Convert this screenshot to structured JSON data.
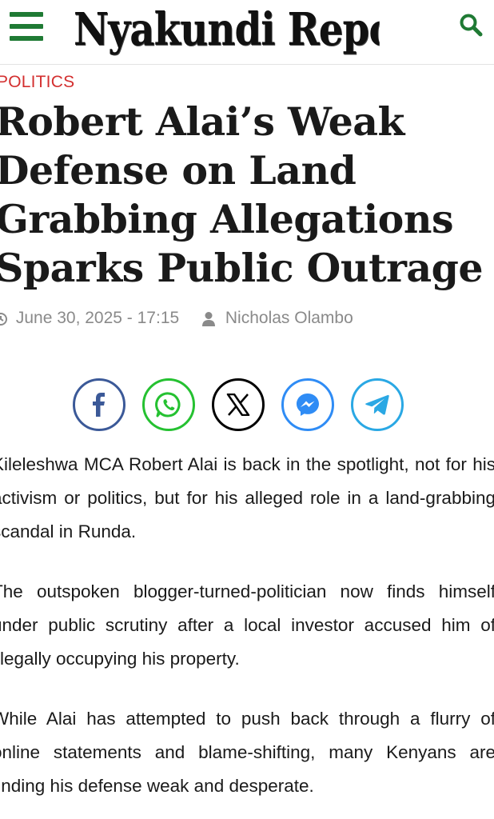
{
  "header": {
    "site_title": "Nyakundi Report",
    "menu_icon": "hamburger-menu-icon",
    "search_icon": "search-icon",
    "accent_color": "#1f7a34"
  },
  "article": {
    "category": "POLITICS",
    "title": "Robert Alai’s Weak Defense on Land Grabbing Allegations Sparks Public Outrage",
    "date": "June 30, 2025 - 17:15",
    "author": "Nicholas Olambo",
    "category_color": "#d32f2f",
    "paragraphs": [
      "Kileleshwa MCA Robert Alai is back in the spotlight, not for his activism or politics, but for his alleged role in a land-grabbing scandal in Runda.",
      "The outspoken blogger-turned-politician now finds himself under public scrutiny after a local investor accused him of illegally occupying his property.",
      "While Alai has attempted to push back through a flurry of online statements and blame-shifting, many Kenyans are finding his defense weak and desperate."
    ]
  },
  "share_buttons": [
    {
      "name": "facebook",
      "icon": "facebook-icon",
      "color": "#3b5998"
    },
    {
      "name": "whatsapp",
      "icon": "whatsapp-icon",
      "color": "#25c131"
    },
    {
      "name": "x",
      "icon": "x-icon",
      "color": "#000000"
    },
    {
      "name": "messenger",
      "icon": "messenger-icon",
      "color": "#2f8cf5"
    },
    {
      "name": "telegram",
      "icon": "telegram-icon",
      "color": "#2aa8e4"
    }
  ]
}
